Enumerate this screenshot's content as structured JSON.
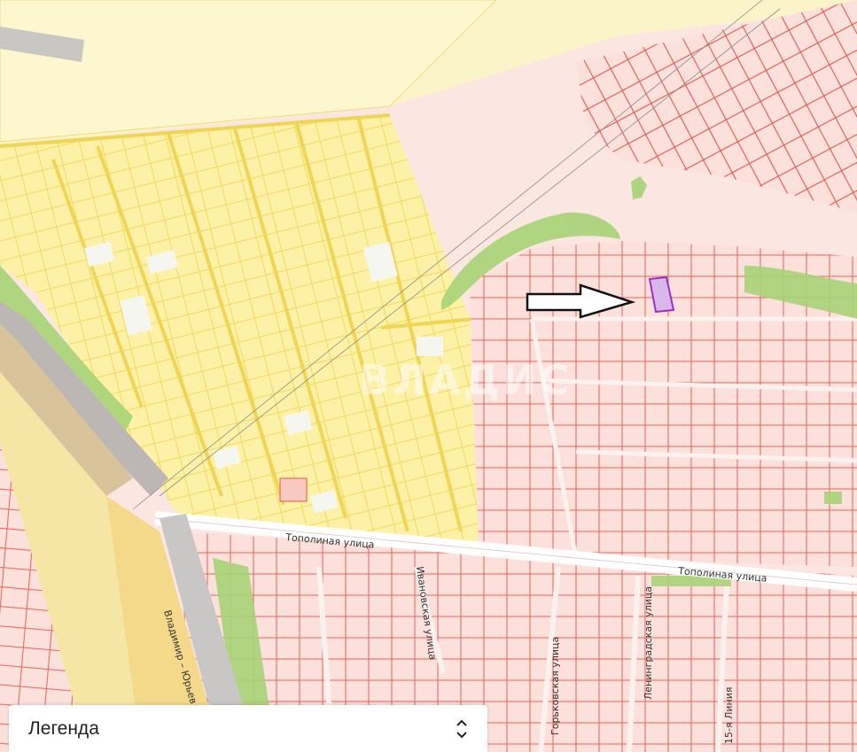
{
  "map": {
    "streets": {
      "topolinaya_1": "Тополиная улица",
      "topolinaya_2": "Тополиная улица",
      "ivanovskaya": "Ивановская улица",
      "gorkovskaya": "Горьковская улица",
      "leningradskaya": "Ленинградская улица",
      "liniya_15": "15-я Линия",
      "highway": "Владимир – Юрьев"
    },
    "watermark": "ВЛАДИС",
    "colors": {
      "snt_fill": "#fdf3b3",
      "snt_border": "#f0dc6a",
      "residential_fill": "#fbe0dc",
      "parcel_line": "#e8564a",
      "green": "#a9d67a",
      "target_parcel": "#c8a0e6",
      "target_border": "#9b2fc9"
    }
  },
  "legend": {
    "label": "Легенда",
    "icon": "chevron-up-down-icon"
  }
}
